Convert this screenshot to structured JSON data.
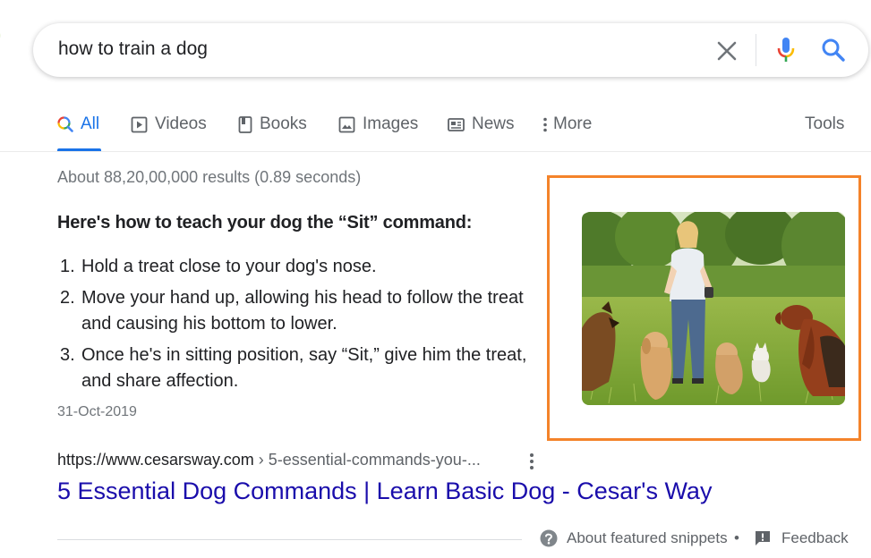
{
  "search": {
    "query": "how to train a dog"
  },
  "tabs": [
    {
      "label": "All",
      "icon": "search-multicolor-icon",
      "active": true
    },
    {
      "label": "Videos",
      "icon": "video-icon"
    },
    {
      "label": "Books",
      "icon": "book-icon"
    },
    {
      "label": "Images",
      "icon": "image-icon"
    },
    {
      "label": "News",
      "icon": "news-icon"
    },
    {
      "label": "More",
      "icon": "more-vert-icon"
    }
  ],
  "tools_label": "Tools",
  "result_stats": "About 88,20,00,000 results (0.89 seconds)",
  "snippet": {
    "heading": "Here's how to teach your dog the “Sit” command:",
    "steps": [
      {
        "num": "1.",
        "text": "Hold a treat close to your dog's nose."
      },
      {
        "num": "2.",
        "text": "Move your hand up, allowing his head to follow the treat and causing his bottom to lower."
      },
      {
        "num": "3.",
        "text": "Once he's in sitting position, say “Sit,” give him the treat, and share affection."
      }
    ],
    "date": "31-Oct-2019",
    "image_icon": "woman-training-dogs-photo",
    "highlight_color": "#f4832a"
  },
  "result": {
    "cite_domain": "https://www.cesarsway.com",
    "cite_path": " › 5-essential-commands-you-...",
    "title": "5 Essential Dog Commands | Learn Basic Dog - Cesar's Way"
  },
  "footer": {
    "about_label": "About featured snippets",
    "separator": "•",
    "feedback_label": "Feedback"
  },
  "colors": {
    "link": "#1a0dab",
    "accent": "#1a73e8",
    "muted": "#70757a"
  }
}
